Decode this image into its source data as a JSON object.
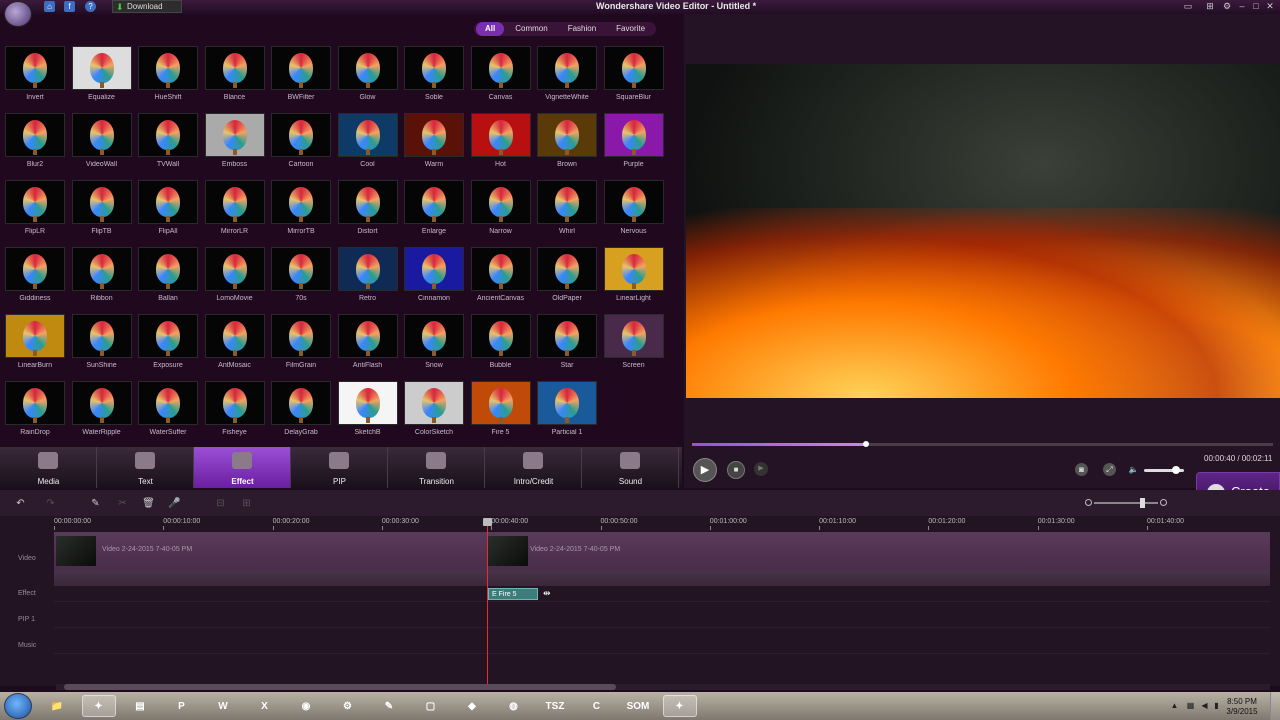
{
  "window": {
    "title": "Wondershare Video Editor - Untitled *",
    "download_label": "Download",
    "quick_icons": [
      "home-icon",
      "facebook-icon",
      "help-icon"
    ],
    "controls": [
      "monitor-icon",
      "cart-icon",
      "settings-icon",
      "minimize-icon",
      "maximize-icon",
      "close-icon"
    ]
  },
  "filters": {
    "items": [
      "All",
      "Common",
      "Fashion",
      "Favorite"
    ],
    "active": "All"
  },
  "effects": [
    "Invert",
    "Equalize",
    "HueShift",
    "Blance",
    "BWFilter",
    "Glow",
    "Soble",
    "Canvas",
    "VignetteWhite",
    "SquareBlur",
    "Blur2",
    "VideoWall",
    "TVWall",
    "Emboss",
    "Cartoon",
    "Cool",
    "Warm",
    "Hot",
    "Brown",
    "Purple",
    "FlipLR",
    "FlipTB",
    "FlipAll",
    "MirrorLR",
    "MirrorTB",
    "Distort",
    "Enlarge",
    "Narrow",
    "Whirl",
    "Nervous",
    "Giddiness",
    "Ribbon",
    "Ballan",
    "LomoMovie",
    "70s",
    "Retro",
    "Cinnamon",
    "AncientCanvas",
    "OldPaper",
    "LinearLight",
    "LinearBurn",
    "SunShine",
    "Exposure",
    "AntMosaic",
    "FilmGrain",
    "AntiFlash",
    "Snow",
    "Bubble",
    "Star",
    "Screen",
    "RainDrop",
    "WaterRipple",
    "WaterSuffer",
    "Fisheye",
    "DelayGrab",
    "SketchB",
    "ColorSketch",
    "Fire 5",
    "Particial 1"
  ],
  "categories": [
    {
      "label": "Media",
      "icon": "media-icon"
    },
    {
      "label": "Text",
      "icon": "text-icon"
    },
    {
      "label": "Effect",
      "icon": "effect-icon",
      "active": true
    },
    {
      "label": "PIP",
      "icon": "pip-icon"
    },
    {
      "label": "Transition",
      "icon": "transition-icon"
    },
    {
      "label": "Intro/Credit",
      "icon": "intro-credit-icon"
    },
    {
      "label": "Sound",
      "icon": "sound-icon"
    }
  ],
  "player": {
    "time": "00:00:40 / 00:02:11",
    "progress_fraction": 0.3,
    "volume_fraction": 0.8,
    "play_icon": "▶",
    "stop_icon": "■",
    "next_icon": "▶"
  },
  "create_label": "Create",
  "timeline": {
    "ticks": [
      "00:00:00:00",
      "00:00:10:00",
      "00:00:20:00",
      "00:00:30:00",
      "00:00:40:00",
      "00:00:50:00",
      "00:01:00:00",
      "00:01:10:00",
      "00:01:20:00",
      "00:01:30:00",
      "00:01:40:00"
    ],
    "tracks": [
      "Video",
      "Effect",
      "PIP 1",
      "Music"
    ],
    "video_clips": [
      "Video 2-24-2015 7-40-05 PM",
      "Video 2-24-2015 7-40-05 PM"
    ],
    "effect_clip": "Fire 5",
    "zoom_fraction": 0.75
  },
  "taskbar": {
    "apps": [
      {
        "name": "explorer-icon",
        "glyph": "📁"
      },
      {
        "name": "wondershare-icon",
        "glyph": "✦",
        "active": true
      },
      {
        "name": "notepad-icon",
        "glyph": "▤"
      },
      {
        "name": "powerpoint-icon",
        "glyph": "P"
      },
      {
        "name": "word-icon",
        "glyph": "W"
      },
      {
        "name": "excel-icon",
        "glyph": "X"
      },
      {
        "name": "chrome-icon",
        "glyph": "◉"
      },
      {
        "name": "tool-icon",
        "glyph": "⚙"
      },
      {
        "name": "paint-icon",
        "glyph": "✎"
      },
      {
        "name": "window-icon",
        "glyph": "▢"
      },
      {
        "name": "cube-icon",
        "glyph": "◆"
      },
      {
        "name": "globe-icon",
        "glyph": "◍"
      },
      {
        "name": "tsz-icon",
        "glyph": "TSZ"
      },
      {
        "name": "camtasia-icon",
        "glyph": "C"
      },
      {
        "name": "som-icon",
        "glyph": "SOM"
      },
      {
        "name": "editor-icon",
        "glyph": "✦",
        "active": true
      }
    ],
    "clock_time": "8:50 PM",
    "clock_date": "3/9/2015"
  }
}
